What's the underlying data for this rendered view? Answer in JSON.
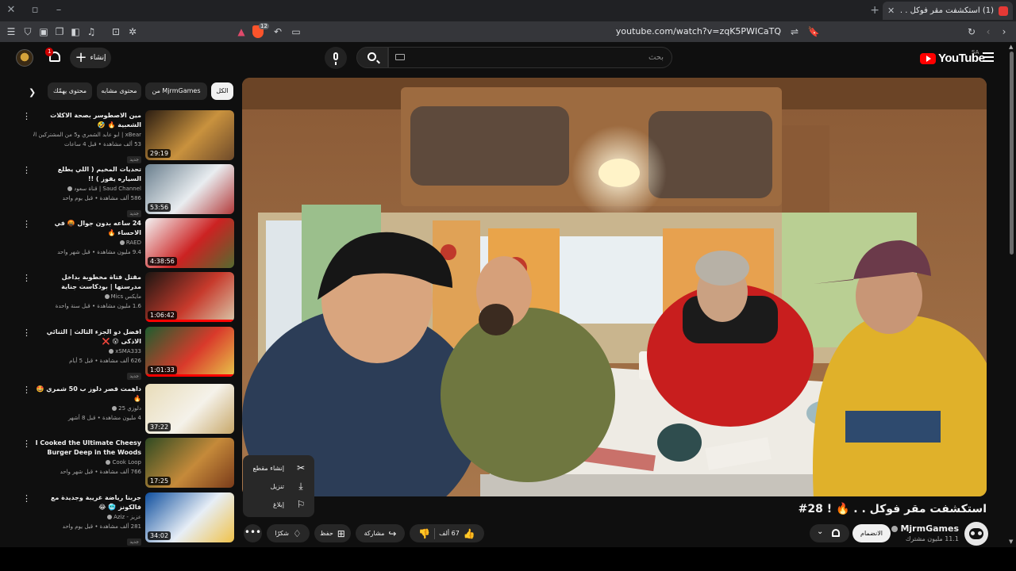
{
  "browser": {
    "tab_title": "(1) استكشفت مقر فوكل . . 🔥 | 28#",
    "url": "youtube.com/watch?v=zqK5PWICaTQ",
    "shield_count": "12"
  },
  "masthead": {
    "logo_text": "YouTube",
    "country": "SA",
    "search_placeholder": "بحث",
    "create_label": "إنشاء",
    "notification_count": "1"
  },
  "video": {
    "title": "استكشفت مقر فوكل . . 🔥 ! 28#",
    "channel": "MjrmGames",
    "subscribers": "11.1 مليون مشترك",
    "join_label": "الانضمام",
    "likes": "67 ألف",
    "share_label": "مشاركة",
    "save_label": "حفظ",
    "thanks_label": "شكرًا",
    "more_menu": [
      {
        "label": "إنشاء مقطع",
        "icon": "scissors-icon"
      },
      {
        "label": "تنزيل",
        "icon": "download-icon"
      },
      {
        "label": "إبلاغ",
        "icon": "flag-icon"
      }
    ]
  },
  "sidebar": {
    "chips": [
      "الكل",
      "من MjrmGames",
      "محتوى مشابه",
      "محتوى يهمّك"
    ],
    "items": [
      {
        "title": "مين الاصطوسر بصحة الاكلات الشعبية 🔥 🤣",
        "channel": "xBear | ابو عابد الشمري و5 من المشتركين الآخرين",
        "meta": "53 ألف مشاهدة • قبل 4 ساعات",
        "badge": "جديد",
        "duration": "29:19",
        "progress": 0
      },
      {
        "title": "تحديات المخيم ( اللي يطلع السياره يفوز ) !!",
        "channel": "Saud Channel | قناة سعود",
        "meta": "586 ألف مشاهدة • قبل يوم واحد",
        "badge": "جديد",
        "duration": "53:56",
        "progress": 0
      },
      {
        "title": "24 ساعه بدون جوال 🤬 في الاحساء 🔥",
        "channel": "RAED",
        "meta": "9.4 مليون مشاهدة • قبل شهر واحد",
        "badge": "",
        "duration": "4:38:56",
        "progress": 0
      },
      {
        "title": "مقتل فتاة مخطوبة بداخل مدرستها | بودكاست جناية",
        "channel": "مايكس Mics",
        "meta": "1.6 مليون مشاهدة • قبل سنة واحدة",
        "badge": "",
        "duration": "1:06:42",
        "progress": 1
      },
      {
        "title": "افضل دو الجزء الثالث | الثنائي الاذكى 😮 ❌",
        "channel": "xSMA333",
        "meta": "626 ألف مشاهدة • قبل 5 أيام",
        "badge": "جديد",
        "duration": "1:01:33",
        "progress": 1
      },
      {
        "title": "داهمت قصر دلوز ب 50 شمري 🤩 🔥",
        "channel": "دلوزي 25",
        "meta": "4 مليون مشاهدة • قبل 8 أشهر",
        "badge": "",
        "duration": "37:22",
        "progress": 0
      },
      {
        "title": "I Cooked the Ultimate Cheesy Burger Deep in the Woods",
        "channel": "Cook Loop",
        "meta": "766 ألف مشاهدة • قبل شهر واحد",
        "badge": "",
        "duration": "17:25",
        "progress": 0
      },
      {
        "title": "جربنا رياضة غريبة وجديدة مع فالكونز 🥶 😂",
        "channel": "عزيز - Aziz",
        "meta": "281 ألف مشاهدة • قبل يوم واحد",
        "badge": "جديد",
        "duration": "34:02",
        "progress": 0
      }
    ]
  },
  "colors": {
    "background": "#0f0f0f",
    "brand_red": "#ff0000",
    "chip_bg": "#272727"
  }
}
